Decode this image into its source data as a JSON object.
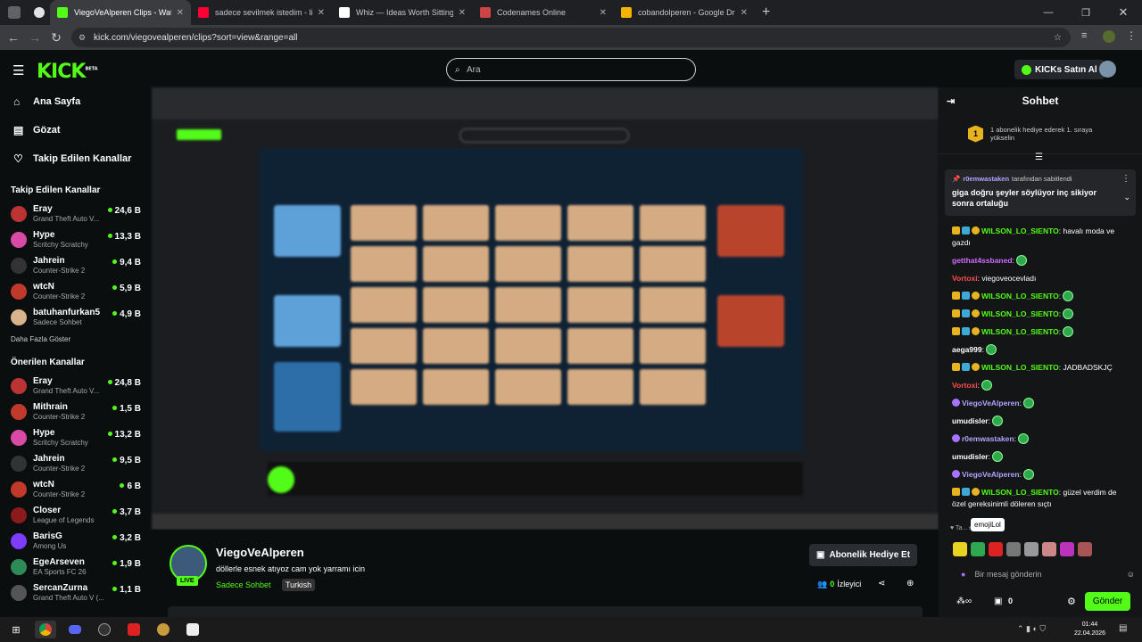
{
  "browser": {
    "tabs": [
      {
        "title": "ViegoVeAlperen Clips - Watch ",
        "color": "#53fc18",
        "active": true
      },
      {
        "title": "sadece sevilmek istedim - lin pe",
        "color": "#ff0033",
        "active": false
      },
      {
        "title": "Whiz — Ideas Worth Sitting Wi",
        "color": "#ffffff",
        "active": false
      },
      {
        "title": "Codenames Online",
        "color": "#c44",
        "active": false
      },
      {
        "title": "cobandolperen - Google Drive",
        "color": "#f4b400",
        "active": false
      }
    ],
    "url": "kick.com/viegovealperen/clips?sort=view&range=all"
  },
  "header": {
    "logo": "KICK",
    "logo_sup": "BETA",
    "search_placeholder": "Ara",
    "buy_kicks": "KICKs Satın Al"
  },
  "sidebar": {
    "menu": [
      {
        "label": "Ana Sayfa",
        "icon": "home-icon"
      },
      {
        "label": "Gözat",
        "icon": "browse-icon"
      },
      {
        "label": "Takip Edilen Kanallar",
        "icon": "heart-icon"
      }
    ],
    "followed_title": "Takip Edilen Kanallar",
    "followed": [
      {
        "name": "Eray",
        "game": "Grand Theft Auto V...",
        "viewers": "24,6 B",
        "color": "#b33"
      },
      {
        "name": "Hype",
        "game": "Scritchy Scratchy",
        "viewers": "13,3 B",
        "color": "#d94aa7"
      },
      {
        "name": "Jahrein",
        "game": "Counter-Strike 2",
        "viewers": "9,4 B",
        "color": "#333"
      },
      {
        "name": "wtcN",
        "game": "Counter-Strike 2",
        "viewers": "5,9 B",
        "color": "#c0392b"
      },
      {
        "name": "batuhanfurkan5",
        "game": "Sadece Sohbet",
        "viewers": "4,9 B",
        "color": "#d9b38c"
      }
    ],
    "more_label": "Daha Fazla Göster",
    "recommended_title": "Önerilen Kanallar",
    "recommended": [
      {
        "name": "Eray",
        "game": "Grand Theft Auto V...",
        "viewers": "24,8 B",
        "color": "#b33"
      },
      {
        "name": "Mithrain",
        "game": "Counter-Strike 2",
        "viewers": "1,5 B",
        "color": "#c0392b"
      },
      {
        "name": "Hype",
        "game": "Scritchy Scratchy",
        "viewers": "13,2 B",
        "color": "#d94aa7"
      },
      {
        "name": "Jahrein",
        "game": "Counter-Strike 2",
        "viewers": "9,5 B",
        "color": "#333"
      },
      {
        "name": "wtcN",
        "game": "Counter-Strike 2",
        "viewers": "6 B",
        "color": "#c0392b"
      },
      {
        "name": "Closer",
        "game": "League of Legends",
        "viewers": "3,7 B",
        "color": "#8b1a1a"
      },
      {
        "name": "BarisG",
        "game": "Among Us",
        "viewers": "3,2 B",
        "color": "#7d3cff"
      },
      {
        "name": "EgeArseven",
        "game": "EA Sports FC 26",
        "viewers": "1,9 B",
        "color": "#2e8b57"
      },
      {
        "name": "SercanZurna",
        "game": "Grand Theft Auto V (...",
        "viewers": "1,1 B",
        "color": "#555"
      }
    ]
  },
  "stream": {
    "channel": "ViegoVeAlperen",
    "title": "döllerle esnek atıyoz cam yok yarramı icin",
    "category": "Sadece Sohbet",
    "tag": "Turkish",
    "live_label": "LIVE",
    "gift_sub": "Abonelik Hediye Et",
    "viewers_count": "0",
    "viewers_label": "İzleyici"
  },
  "chat": {
    "title": "Sohbet",
    "gift_banner": "1 abonelik hediye ederek 1. sıraya yükselin",
    "gift_rank": "1",
    "pinned_by": "r0emwastaken",
    "pinned_suffix": "tarafından sabitlendi",
    "pinned_text": "giga doğru şeyler söylüyor inç sikiyor sonra ortaluğu",
    "messages": [
      {
        "user": "WILSON_LO_SIENTO",
        "text": ": havalı moda ve gazdı",
        "color": "#53fc18"
      },
      {
        "user": "getthat4ssbaned",
        "text": ":",
        "color": "#d16bff"
      },
      {
        "user": "Vortoxi",
        "text": ": viegoveocevladı",
        "color": "#ff4d4d"
      },
      {
        "user": "WILSON_LO_SIENTO",
        "text": ":",
        "color": "#53fc18"
      },
      {
        "user": "WILSON_LO_SIENTO",
        "text": ":",
        "color": "#53fc18"
      },
      {
        "user": "WILSON_LO_SIENTO",
        "text": ":",
        "color": "#53fc18"
      },
      {
        "user": "aega999",
        "text": ":",
        "color": "#fff"
      },
      {
        "user": "WILSON_LO_SIENTO",
        "text": ": JADBADSKJÇ",
        "color": "#53fc18"
      },
      {
        "user": "Vortoxi",
        "text": ":",
        "color": "#ff4d4d"
      },
      {
        "user": "ViegoVeAlperen",
        "text": ":",
        "color": "#b0a4ff"
      },
      {
        "user": "umudisler",
        "text": ":",
        "color": "#fff"
      },
      {
        "user": "r0emwastaken",
        "text": ":",
        "color": "#b0a4ff"
      },
      {
        "user": "umudisler",
        "text": ":",
        "color": "#fff"
      },
      {
        "user": "ViegoVeAlperen",
        "text": ":",
        "color": "#b0a4ff"
      },
      {
        "user": "WILSON_LO_SIENTO",
        "text": ": güzel verdim de özel gereksinimli döleren sıçtı",
        "color": "#53fc18"
      }
    ],
    "tooltip": "emojiLol",
    "input_placeholder": "Bir mesaj gönderin",
    "send_label": "Gönder",
    "points": "0"
  },
  "taskbar": {
    "time": "01:44",
    "date": "22.04.2026"
  }
}
